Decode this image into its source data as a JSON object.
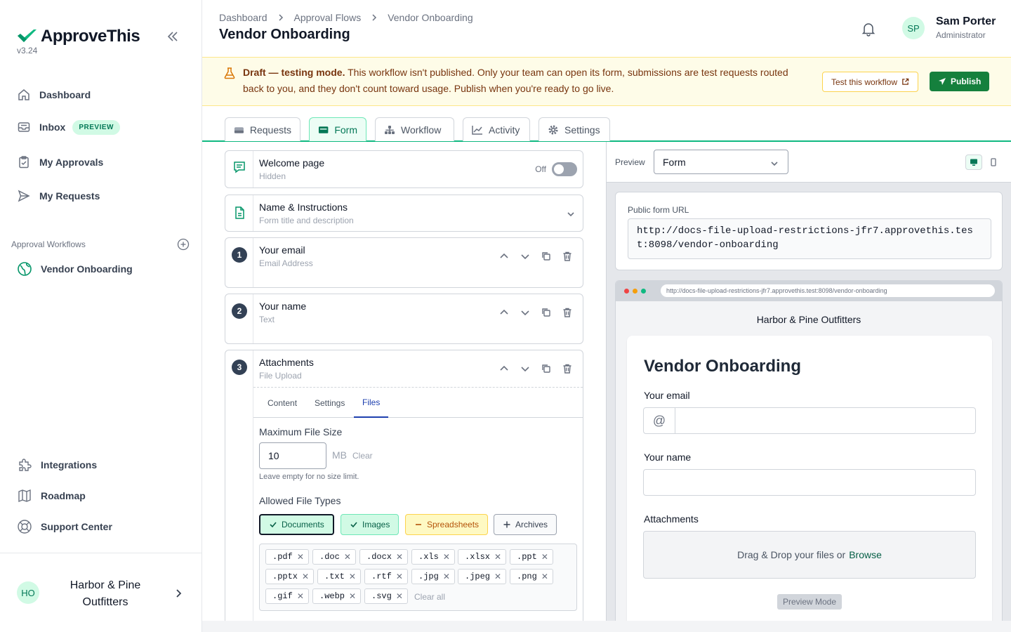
{
  "app": {
    "name": "ApproveThis",
    "version": "v3.24"
  },
  "sidebar": {
    "nav": [
      {
        "label": "Dashboard",
        "icon": "home-icon"
      },
      {
        "label": "Inbox",
        "badge": "PREVIEW",
        "icon": "inbox-icon"
      },
      {
        "label": "My Approvals",
        "icon": "clipboard-check-icon"
      },
      {
        "label": "My Requests",
        "icon": "send-icon"
      }
    ],
    "workflows_label": "Approval Workflows",
    "workflows": [
      {
        "label": "Vendor Onboarding",
        "icon": "globe-icon"
      }
    ],
    "footer_nav": [
      {
        "label": "Integrations",
        "icon": "puzzle-icon"
      },
      {
        "label": "Roadmap",
        "icon": "map-icon"
      },
      {
        "label": "Support Center",
        "icon": "lifebuoy-icon"
      }
    ],
    "org": {
      "initials": "HO",
      "name": "Harbor & Pine Outfitters"
    }
  },
  "header": {
    "breadcrumbs": [
      "Dashboard",
      "Approval Flows",
      "Vendor Onboarding"
    ],
    "title": "Vendor Onboarding",
    "user": {
      "initials": "SP",
      "name": "Sam Porter",
      "role": "Administrator"
    }
  },
  "banner": {
    "strong": "Draft — testing mode.",
    "text": " This workflow isn't published. Only your team can open its form, submissions are test requests routed back to you, and they don't count toward usage. Publish when you're ready to go live.",
    "test_label": "Test this workflow",
    "publish_label": "Publish"
  },
  "tabs": [
    {
      "label": "Requests",
      "icon": "tray-icon"
    },
    {
      "label": "Form",
      "icon": "form-icon",
      "active": true
    },
    {
      "label": "Workflow",
      "icon": "hierarchy-icon"
    },
    {
      "label": "Activity",
      "icon": "chart-line-icon"
    },
    {
      "label": "Settings",
      "icon": "gear-icon"
    }
  ],
  "editor": {
    "welcome": {
      "title": "Welcome page",
      "sub": "Hidden",
      "toggle_label": "Off",
      "enabled": false
    },
    "instructions": {
      "title": "Name & Instructions",
      "sub": "Form title and description"
    },
    "fields": [
      {
        "num": "1",
        "title": "Your email",
        "sub": "Email Address"
      },
      {
        "num": "2",
        "title": "Your name",
        "sub": "Text"
      },
      {
        "num": "3",
        "title": "Attachments",
        "sub": "File Upload"
      }
    ],
    "subtabs": [
      "Content",
      "Settings",
      "Files"
    ],
    "active_subtab": "Files",
    "files": {
      "max_size_label": "Maximum File Size",
      "max_size_value": "10",
      "unit": "MB",
      "clear": "Clear",
      "hint": "Leave empty for no size limit.",
      "types_label": "Allowed File Types",
      "categories": [
        {
          "label": "Documents",
          "state": "selected"
        },
        {
          "label": "Images",
          "state": "selected"
        },
        {
          "label": "Spreadsheets",
          "state": "partial"
        },
        {
          "label": "Archives",
          "state": "off"
        }
      ],
      "extensions": [
        ".pdf",
        ".doc",
        ".docx",
        ".xls",
        ".xlsx",
        ".ppt",
        ".pptx",
        ".txt",
        ".rtf",
        ".jpg",
        ".jpeg",
        ".png",
        ".gif",
        ".webp",
        ".svg"
      ],
      "clear_all": "Clear all"
    }
  },
  "preview": {
    "label": "Preview",
    "select_value": "Form",
    "url_label": "Public form URL",
    "url": "http://docs-file-upload-restrictions-jfr7.approvethis.test:8098/vendor-onboarding",
    "company": "Harbor & Pine Outfitters",
    "form_title": "Vendor Onboarding",
    "fields": [
      {
        "label": "Your email"
      },
      {
        "label": "Your name"
      },
      {
        "label": "Attachments"
      }
    ],
    "drop_text": "Drag & Drop your files or",
    "browse": "Browse",
    "mode_badge": "Preview Mode"
  }
}
